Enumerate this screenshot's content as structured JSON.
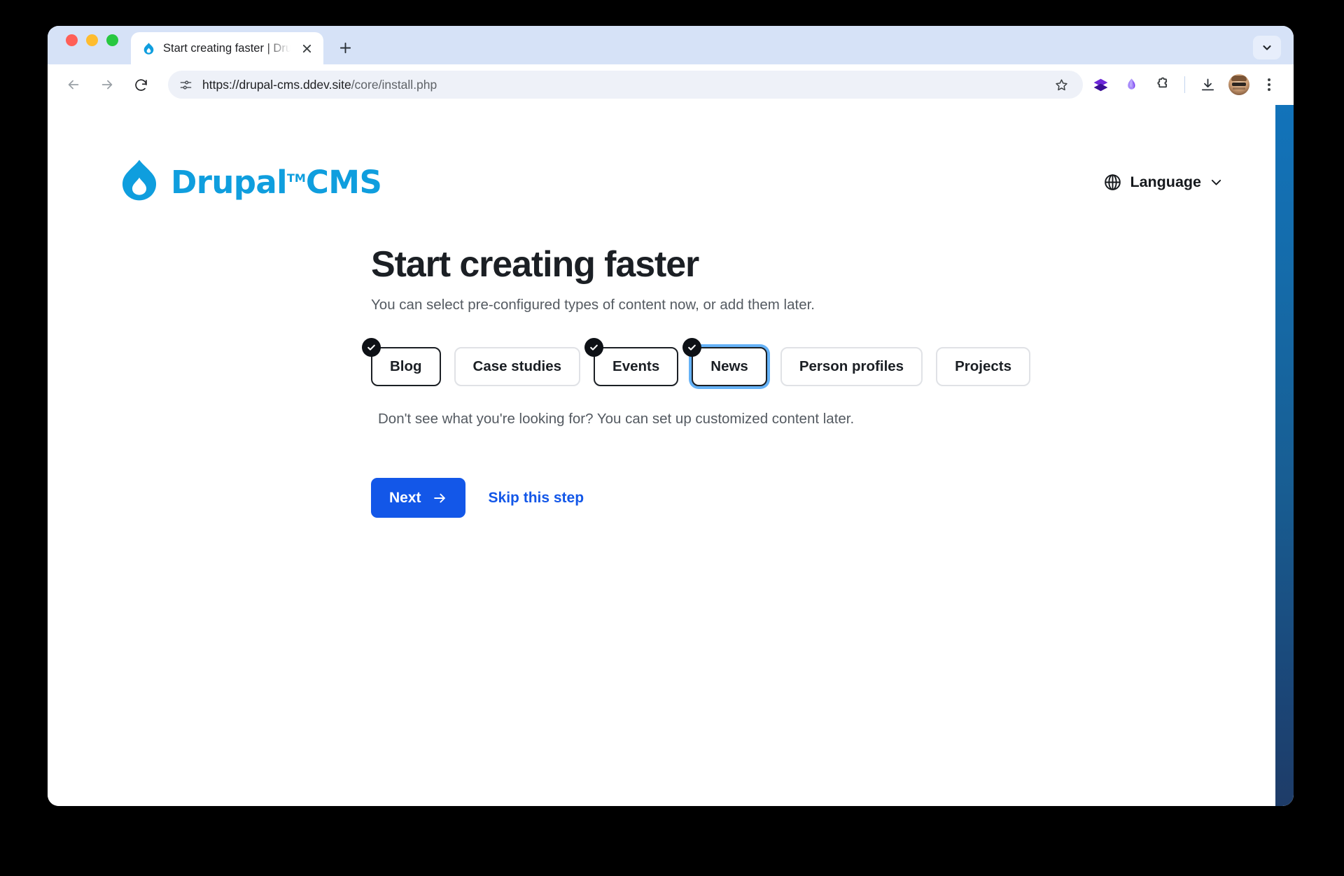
{
  "browser": {
    "traffic_lights": [
      "close",
      "minimize",
      "maximize"
    ],
    "tab": {
      "title": "Start creating faster | Drupal C",
      "favicon": "drupal-droplet-icon",
      "close_icon": "close-icon"
    },
    "new_tab_icon": "plus-icon",
    "tab_list_icon": "chevron-down-icon",
    "back_icon": "arrow-left-icon",
    "forward_icon": "arrow-right-icon",
    "reload_icon": "reload-icon",
    "omnibox": {
      "site_info_icon": "tune-icon",
      "url_host": "https://drupal-cms.ddev.site",
      "url_path": "/core/install.php",
      "bookmark_icon": "star-icon"
    },
    "extensions": [
      {
        "name": "layers-extension-icon",
        "color": "#4b21b5"
      },
      {
        "name": "gem-extension-icon",
        "color": "#8b5cf6"
      },
      {
        "name": "puzzle-extensions-icon",
        "color": "#3c4043"
      }
    ],
    "download_icon": "download-icon",
    "avatar": "user-avatar",
    "menu_icon": "three-dot-menu-icon"
  },
  "page": {
    "logo": {
      "icon": "drupal-droplet-icon",
      "wordmark_primary": "Drupal",
      "wordmark_tm": "TM",
      "wordmark_secondary": "CMS",
      "color": "#0f9ede"
    },
    "language_switcher": {
      "icon": "globe-icon",
      "label": "Language",
      "chevron": "chevron-down-icon"
    },
    "title": "Start creating faster",
    "subtitle": "You can select pre-configured types of content now, or add them later.",
    "content_types": [
      {
        "label": "Blog",
        "selected": true,
        "focused": false
      },
      {
        "label": "Case studies",
        "selected": false,
        "focused": false
      },
      {
        "label": "Events",
        "selected": true,
        "focused": false
      },
      {
        "label": "News",
        "selected": true,
        "focused": true
      },
      {
        "label": "Person profiles",
        "selected": false,
        "focused": false
      },
      {
        "label": "Projects",
        "selected": false,
        "focused": false
      }
    ],
    "helper_text": "Don't see what you're looking for? You can set up customized content later.",
    "next_button": {
      "label": "Next",
      "icon": "arrow-right-icon",
      "color": "#1357e8"
    },
    "skip_link": "Skip this step",
    "edge_strip": {
      "top_color": "#1273ba",
      "bottom_color": "#1e3c68"
    }
  }
}
